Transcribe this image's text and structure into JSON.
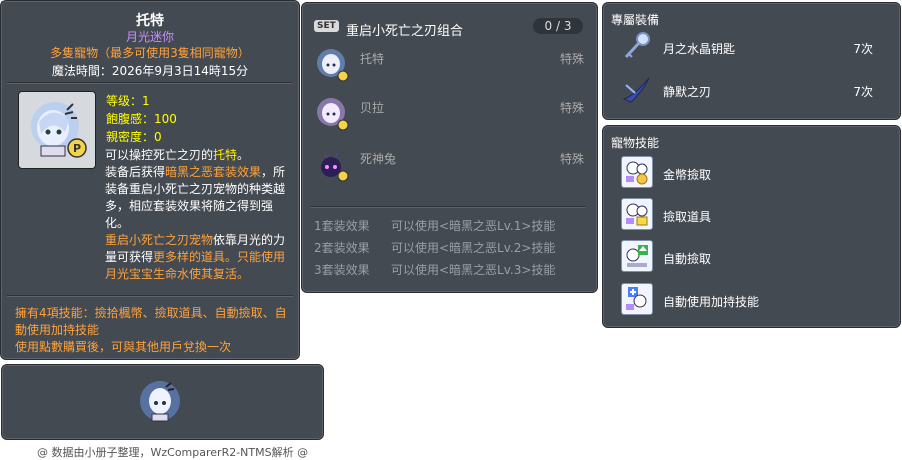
{
  "item_id": "05002365",
  "pet": {
    "name": "托特",
    "subtitle": "月光迷你",
    "description_line": "多隻寵物（最多可使用3隻相同寵物）",
    "magic_time": "魔法時間：2026年9月3日14時15分",
    "stats": {
      "level": "等级：1",
      "fullness": "飽腹感：100",
      "intimacy": "親密度：0"
    },
    "desc": {
      "p1_a": "可以操控死亡之刃的",
      "p1_b": "托特",
      "p1_c": "。",
      "p2_a": "装备后获得",
      "p2_b": "暗黑之恶套装效果",
      "p2_c": "，所装备重启小死亡之刃宠物的种类越多，相应套装效果将随之得到强化。",
      "p3_a": "重启小死亡之刃宠物",
      "p3_b": "依靠月光的力量可获得",
      "p3_c": "更多样的道具",
      "p3_d": "。只能使用月光宝宝生命水使其复活。"
    },
    "skills_note": "擁有4項技能：撿拾楓幣、撿取道具、自動撿取、自動使用加持技能",
    "transfer_note": "使用點數購買後，可與其他用戶兌換一次"
  },
  "footer": "@ 数据由小册子整理，WzComparerR2-NTMS解析 @",
  "set": {
    "badge": "SET",
    "title": "重启小死亡之刃组合",
    "count": "0 / 3",
    "members": [
      {
        "name": "托特",
        "type": "特殊"
      },
      {
        "name": "贝拉",
        "type": "特殊"
      },
      {
        "name": "死神兔",
        "type": "特殊"
      }
    ],
    "effects": [
      {
        "label": "1套装效果",
        "text": "可以使用<暗黑之恶Lv.1>技能"
      },
      {
        "label": "2套装效果",
        "text": "可以使用<暗黑之恶Lv.2>技能"
      },
      {
        "label": "3套装效果",
        "text": "可以使用<暗黑之恶Lv.3>技能"
      }
    ]
  },
  "equip": {
    "header": "專屬裝備",
    "items": [
      {
        "name": "月之水晶钥匙",
        "count": "7次",
        "icon": "key-icon"
      },
      {
        "name": "静默之刃",
        "count": "7次",
        "icon": "blade-icon"
      }
    ]
  },
  "skills": {
    "header": "寵物技能",
    "items": [
      {
        "name": "金幣撿取",
        "icon": "coin-pickup-icon"
      },
      {
        "name": "撿取道具",
        "icon": "item-pickup-icon"
      },
      {
        "name": "自動撿取",
        "icon": "auto-pickup-icon"
      },
      {
        "name": "自動使用加持技能",
        "icon": "auto-buff-icon"
      }
    ]
  }
}
